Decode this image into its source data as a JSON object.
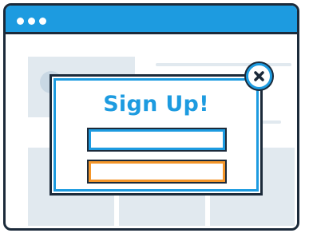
{
  "window": {
    "titlebar_dots": 3
  },
  "modal": {
    "title": "Sign Up!"
  },
  "colors": {
    "primary": "#1d9be0",
    "accent": "#f4962a",
    "outline": "#1b2a3a",
    "placeholder": "#e1e9ef"
  },
  "icons": {
    "close": "close-icon"
  }
}
